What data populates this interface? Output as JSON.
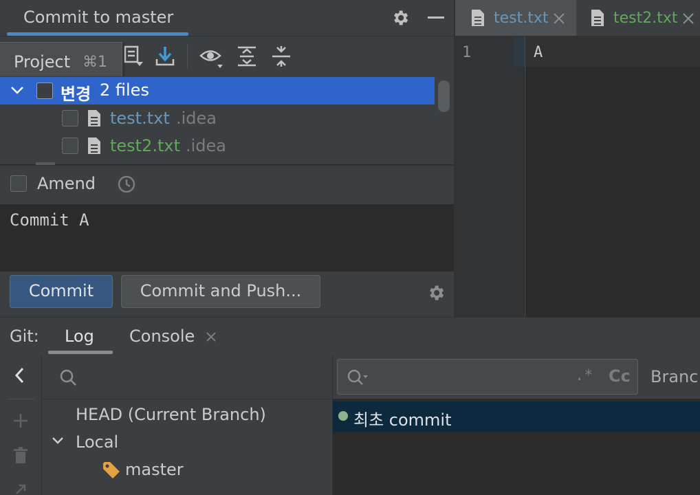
{
  "commit_panel": {
    "title": "Commit to master",
    "tooltip": {
      "label": "Project",
      "shortcut": "⌘1"
    },
    "changelist": {
      "name": "변경",
      "count": "2 files"
    },
    "files": [
      {
        "name": "test.txt",
        "dir": ".idea",
        "color": "#6897bb"
      },
      {
        "name": "test2.txt",
        "dir": ".idea",
        "color": "#62a85c"
      }
    ],
    "amend_label": "Amend",
    "message": "Commit A",
    "commit_button": "Commit",
    "commit_push_button": "Commit and Push..."
  },
  "editor": {
    "tabs": [
      {
        "label": "test.txt",
        "active": true
      },
      {
        "label": "test2.txt",
        "active": false
      }
    ],
    "line_number": "1",
    "content": "A"
  },
  "git_panel": {
    "label": "Git:",
    "tabs": [
      {
        "label": "Log",
        "active": true
      },
      {
        "label": "Console",
        "active": false
      }
    ],
    "branches": {
      "head": "HEAD (Current Branch)",
      "local": "Local",
      "master": "master"
    },
    "log": {
      "filter_regex": ".*",
      "filter_case": "Cc",
      "branch_filter": "Branc",
      "commits": [
        {
          "subject": "최초 commit",
          "dot_color": "#8db38a"
        }
      ]
    }
  },
  "colors": {
    "accent": "#4a88c7",
    "selection": "#2f65ca",
    "commit_button": "#365880"
  }
}
